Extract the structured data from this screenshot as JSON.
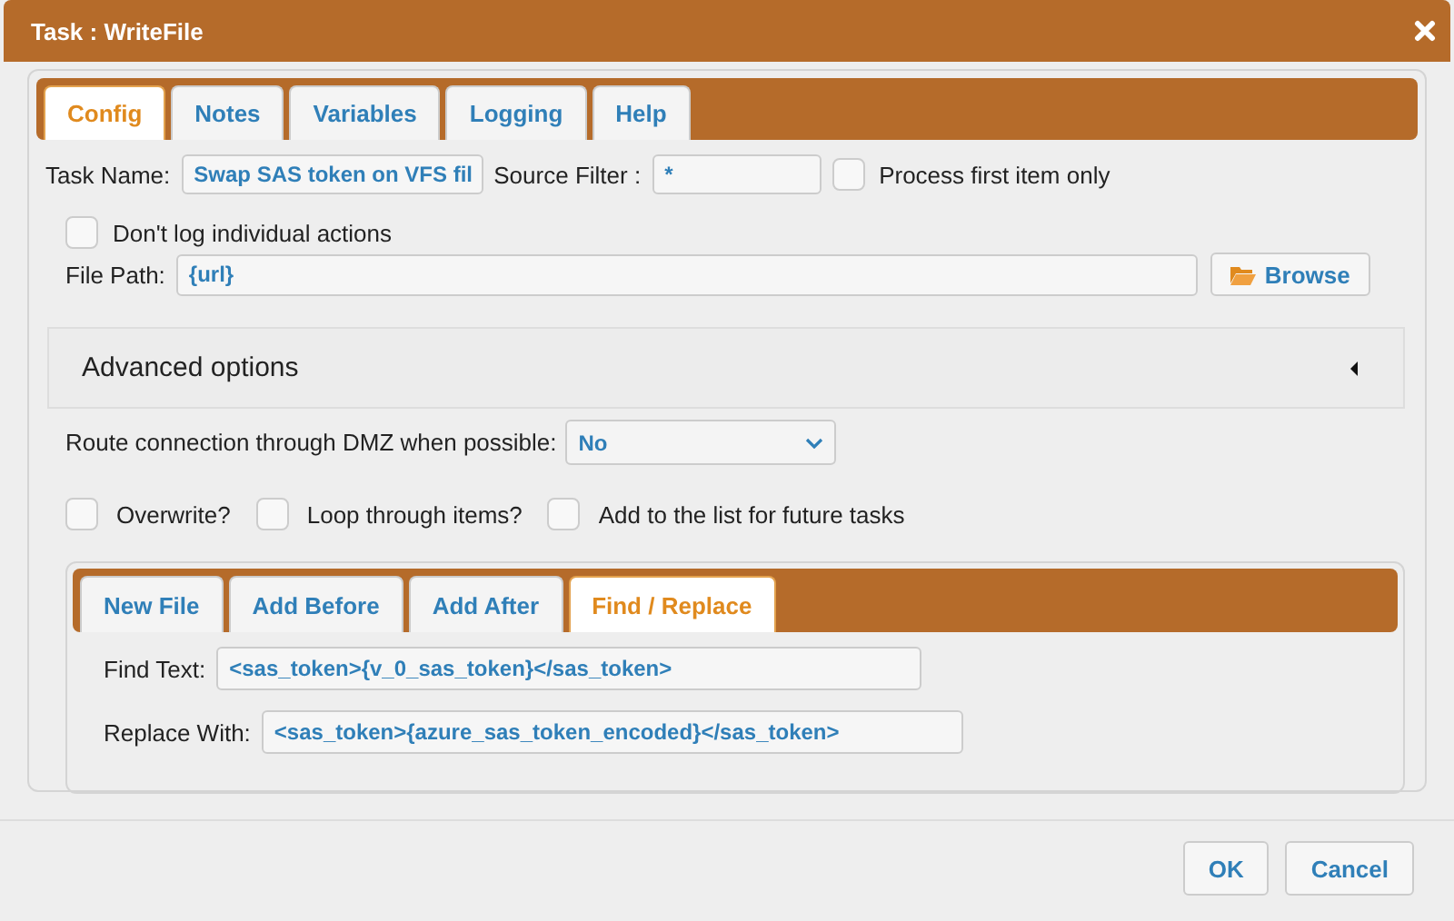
{
  "window": {
    "title": "Task : WriteFile"
  },
  "tabs": [
    {
      "label": "Config",
      "selected": true
    },
    {
      "label": "Notes",
      "selected": false
    },
    {
      "label": "Variables",
      "selected": false
    },
    {
      "label": "Logging",
      "selected": false
    },
    {
      "label": "Help",
      "selected": false
    }
  ],
  "task_name": {
    "label": "Task Name:",
    "value": "Swap SAS token on VFS fil"
  },
  "source_filter": {
    "label": "Source Filter :",
    "value": "*"
  },
  "process_first_item_only": {
    "label": "Process first item only",
    "checked": false
  },
  "dont_log": {
    "label": "Don't log individual actions",
    "checked": false
  },
  "file_path": {
    "label": "File Path:",
    "value": "{url}"
  },
  "browse_button": {
    "label": "Browse"
  },
  "advanced_options": {
    "title": "Advanced options",
    "expanded": false
  },
  "dmz_route": {
    "label": "Route connection through DMZ when possible:",
    "value": "No"
  },
  "options": [
    {
      "label": "Overwrite?",
      "checked": false
    },
    {
      "label": "Loop through items?",
      "checked": false
    },
    {
      "label": "Add to the list for future tasks",
      "checked": false
    }
  ],
  "sub_tabs": [
    {
      "label": "New File",
      "selected": false
    },
    {
      "label": "Add Before",
      "selected": false
    },
    {
      "label": "Add After",
      "selected": false
    },
    {
      "label": "Find / Replace",
      "selected": true
    }
  ],
  "find_text": {
    "label": "Find Text:",
    "value": "<sas_token>{v_0_sas_token}</sas_token>"
  },
  "replace_with": {
    "label": "Replace With:",
    "value": "<sas_token>{azure_sas_token_encoded}</sas_token>"
  },
  "buttons": [
    {
      "label": "OK"
    },
    {
      "label": "Cancel"
    }
  ]
}
